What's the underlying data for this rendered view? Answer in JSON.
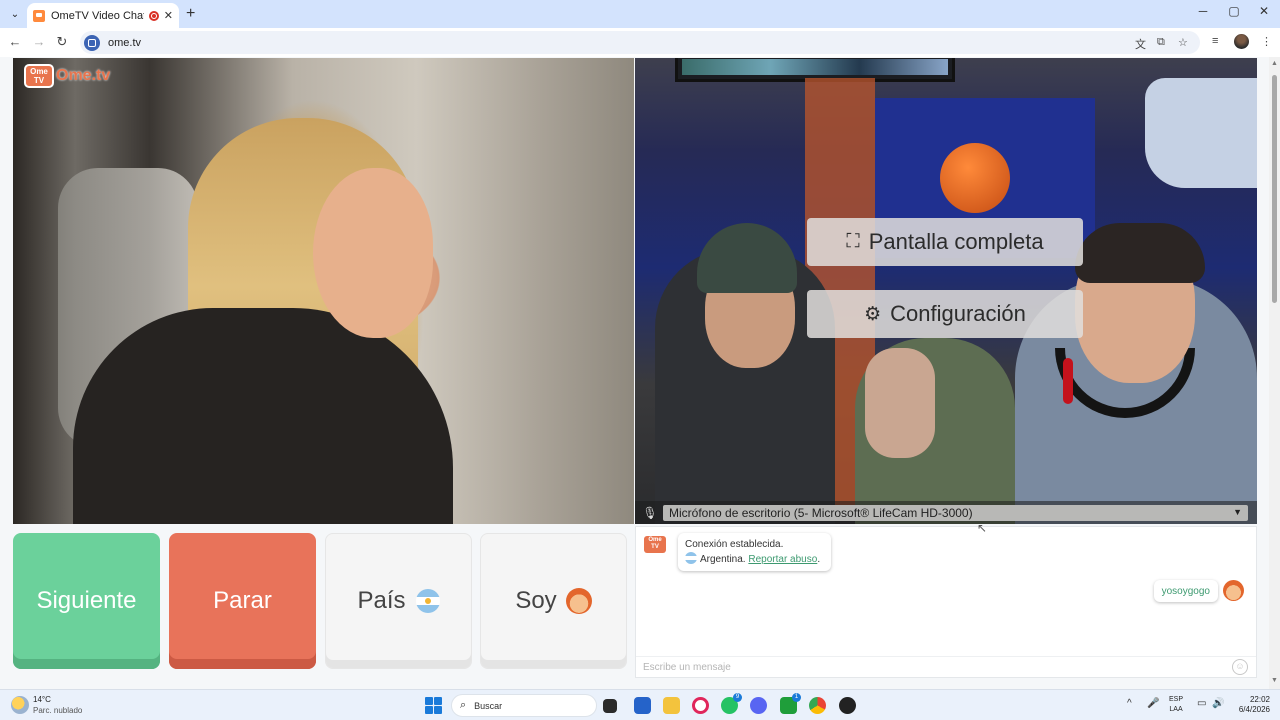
{
  "browser": {
    "tab_title": "OmeTV Video Chat — Ome",
    "tab_close": "✕",
    "new_tab": "+",
    "url": "ome.tv",
    "window_controls": {
      "minimize": "─",
      "maximize": "▢",
      "close": "✕"
    }
  },
  "page": {
    "logo_badge": "Ome TV",
    "logo_text": "Ome.tv",
    "overlay": {
      "fullscreen_label": "Pantalla completa",
      "settings_label": "Configuración"
    },
    "microphone": {
      "selected": "Micrófono de escritorio (5- Microsoft® LifeCam HD-3000)"
    },
    "buttons": {
      "next": "Siguiente",
      "stop": "Parar",
      "country": "País",
      "gender": "Soy"
    },
    "chat": {
      "connection_text": "Conexión establecida.",
      "country_text": "Argentina.",
      "report_link": "Reportar abuso",
      "report_suffix": ".",
      "user_message": "yosoygogo",
      "input_placeholder": "Escribe un mensaje"
    }
  },
  "taskbar": {
    "weather_temp": "14°C",
    "weather_desc": "Parc. nublado",
    "search_label": "Buscar",
    "lang_line1": "ESP",
    "lang_line2": "LAA",
    "time": "22:02",
    "date": "6/4/2026",
    "badges": {
      "whatsapp": "9",
      "xbox": "1"
    }
  },
  "colors": {
    "next_button": "#6bd19b",
    "stop_button": "#e8735a",
    "brand_orange": "#e8744d",
    "link_green": "#3d9a70"
  }
}
